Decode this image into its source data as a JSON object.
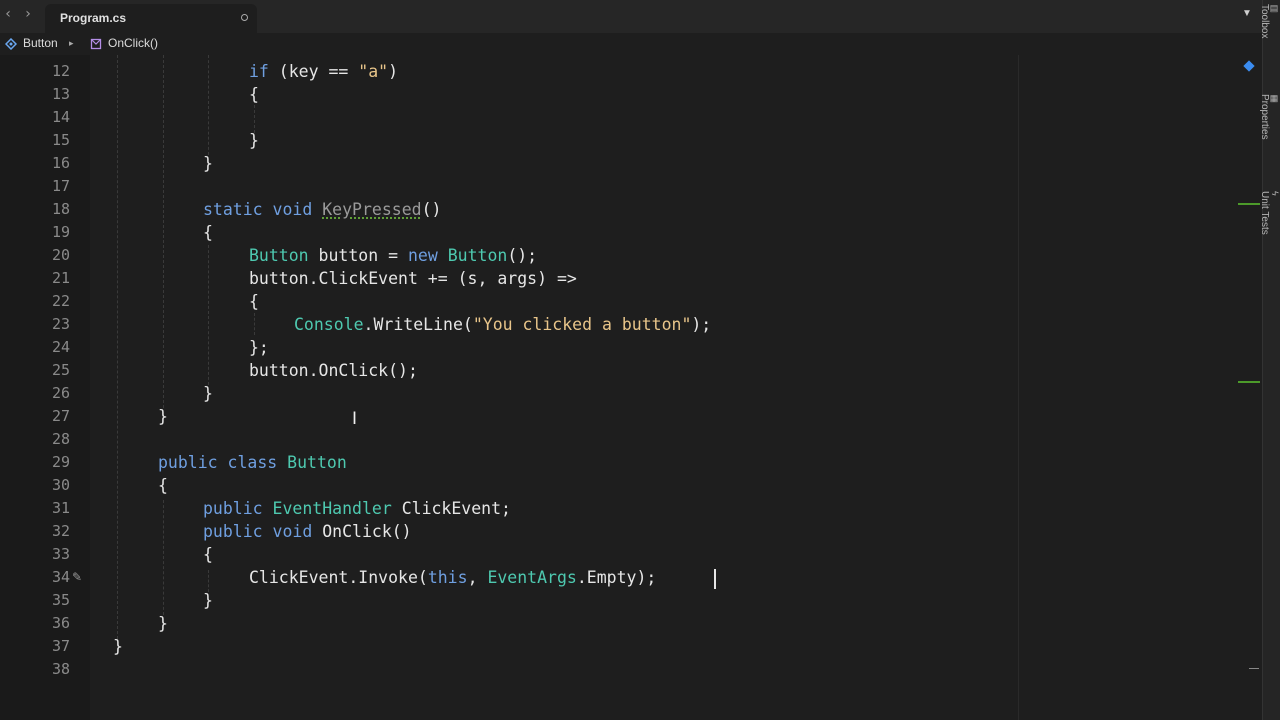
{
  "tabbar": {
    "back_icon": "‹",
    "forward_icon": "›",
    "active_tab": "Program.cs",
    "overflow_icon": "▼"
  },
  "breadcrumb": {
    "class_name": "Button",
    "separator": "▸",
    "method_name": "OnClick()"
  },
  "editor": {
    "line_numbers": [
      "12",
      "13",
      "14",
      "15",
      "16",
      "17",
      "18",
      "19",
      "20",
      "21",
      "22",
      "23",
      "24",
      "25",
      "26",
      "27",
      "28",
      "29",
      "30",
      "31",
      "32",
      "33",
      "34",
      "35",
      "36",
      "37",
      "38"
    ],
    "lines": {
      "l12_if": "if",
      "l12_rest": " (key == ",
      "l12_str": "\"a\"",
      "l12_end": ")",
      "l13": "{",
      "l15": "}",
      "l16": "}",
      "l18_static": "static",
      "l18_void": " void ",
      "l18_name": "KeyPressed",
      "l18_end": "()",
      "l19": "{",
      "l20_type": "Button",
      "l20_mid": " button = ",
      "l20_new": "new",
      "l20_type2": "Button",
      "l20_end": "();",
      "l21": "button.ClickEvent += (s, args) =>",
      "l22": "{",
      "l23_type": "Console",
      "l23_mid": ".WriteLine(",
      "l23_str": "\"You clicked a button\"",
      "l23_end": ");",
      "l24": "};",
      "l25": "button.OnClick();",
      "l26": "}",
      "l27": "}",
      "l29_public": "public",
      "l29_class": " class ",
      "l29_name": "Button",
      "l30": "{",
      "l31_public": "public",
      "l31_type": "EventHandler",
      "l31_end": " ClickEvent;",
      "l32_public": "public",
      "l32_void": " void",
      "l32_end": " OnClick()",
      "l33": "{",
      "l34_start": "ClickEvent.Invoke(",
      "l34_this": "this",
      "l34_comma": ", ",
      "l34_type": "EventArgs",
      "l34_end": ".Empty);",
      "l35": "}",
      "l36": "}",
      "l37": "}"
    }
  },
  "side_panel": {
    "toolbox": "Toolbox",
    "properties": "Properties",
    "unit_tests": "Unit Tests"
  },
  "colors": {
    "keyword": "#6f9fe0",
    "type": "#4ec9b0",
    "string": "#e8c58a",
    "background": "#1e1e1e"
  }
}
